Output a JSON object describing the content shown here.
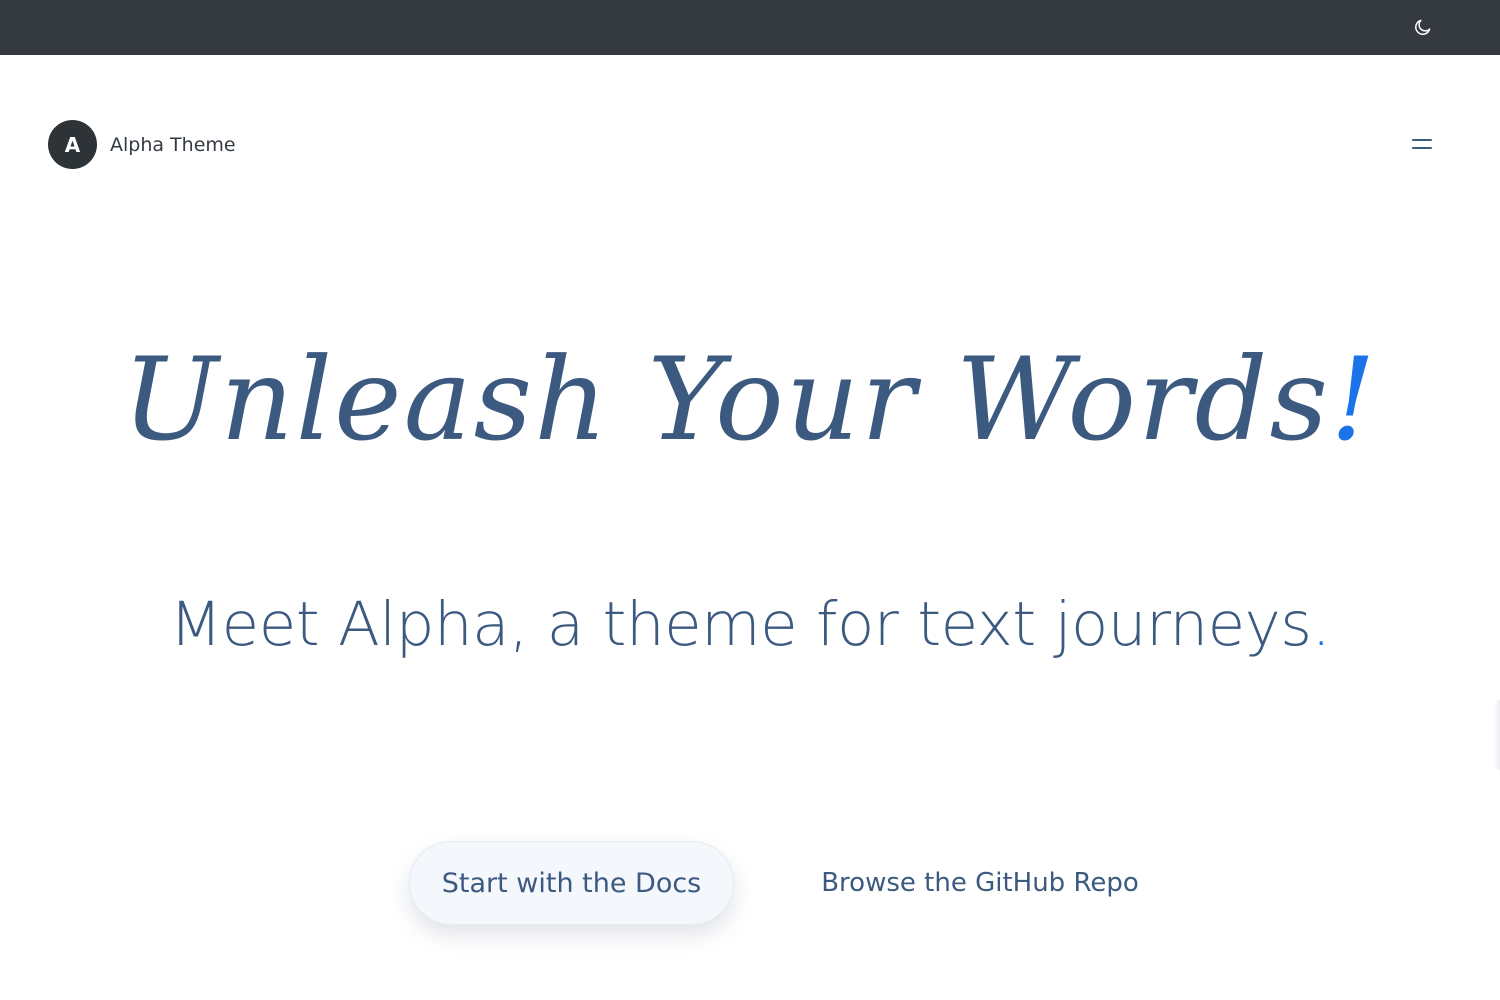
{
  "topbar": {
    "theme_toggle_icon": "moon-icon"
  },
  "header": {
    "logo_letter": "A",
    "brand_name": "Alpha Theme",
    "menu_icon": "hamburger-menu-icon"
  },
  "hero": {
    "title": "Unleash Your Words",
    "title_accent": "!",
    "subtitle": "Meet Alpha, a theme for text journeys",
    "subtitle_accent": "."
  },
  "cta": {
    "primary_label": "Start with the Docs",
    "secondary_label": "Browse the GitHub Repo"
  },
  "colors": {
    "topbar_bg": "#343a40",
    "text_primary": "#3c5a80",
    "accent": "#1a73e8",
    "logo_bg": "#2e3338",
    "button_bg": "#f4f7fb"
  }
}
